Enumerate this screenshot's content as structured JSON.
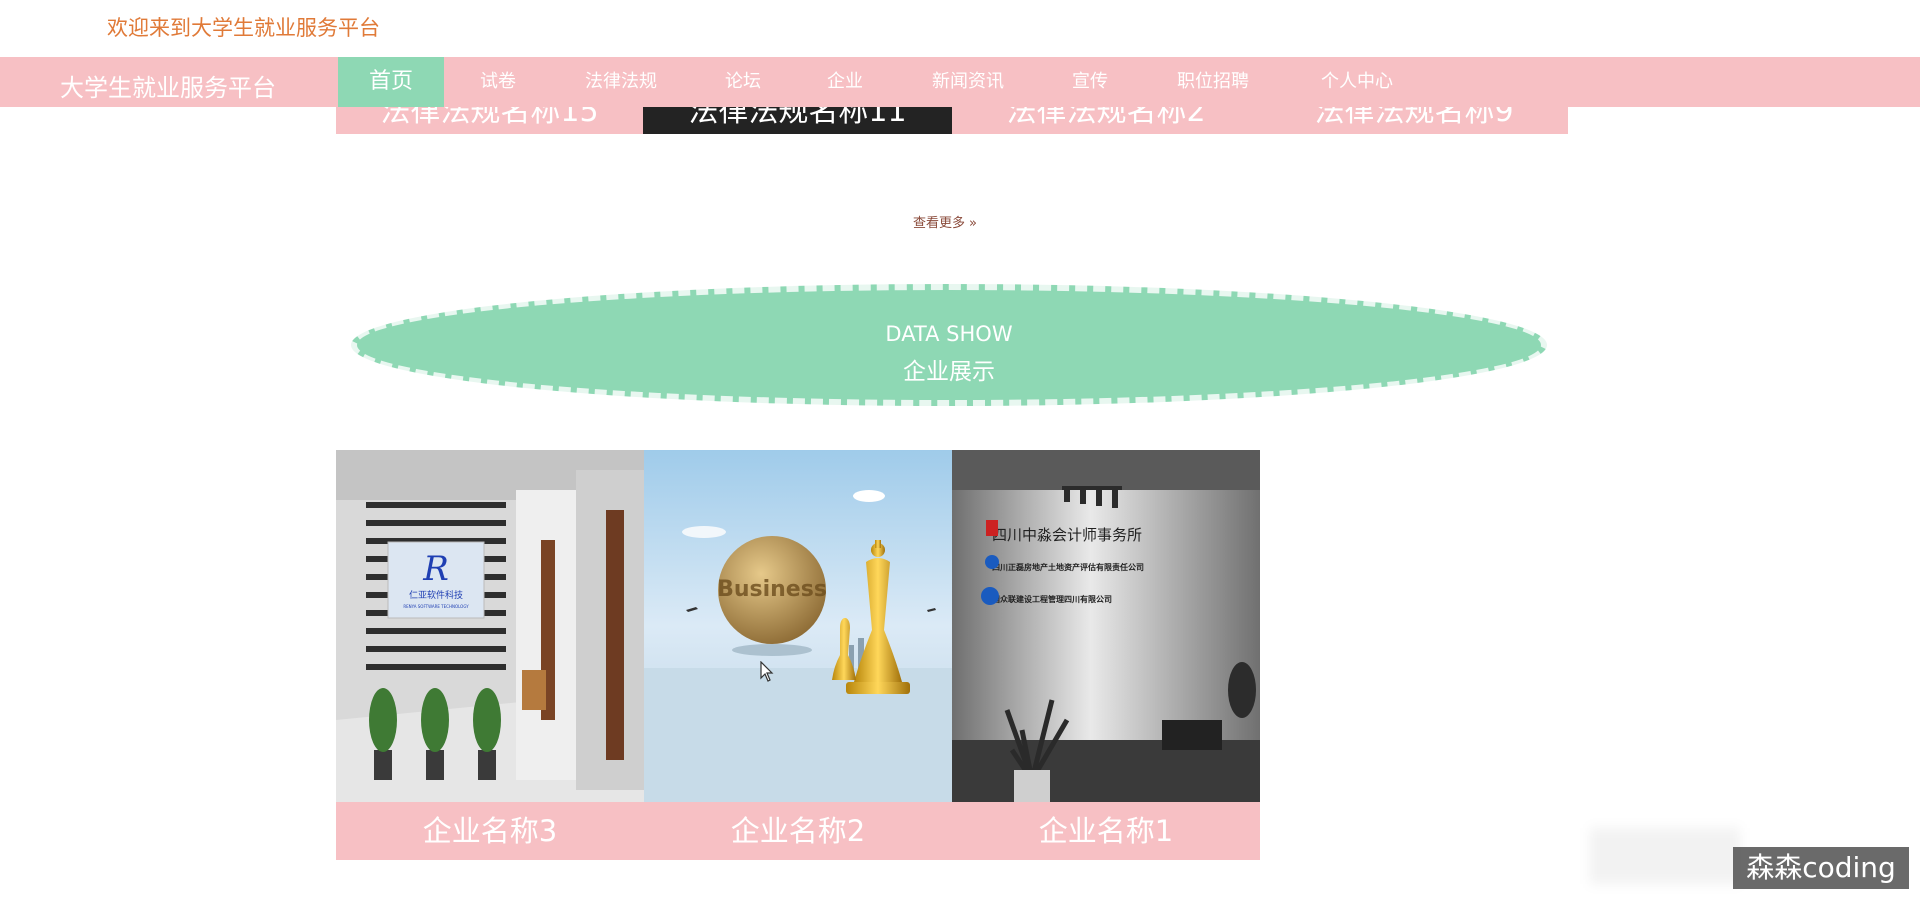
{
  "header": {
    "welcome": "欢迎来到大学生就业服务平台"
  },
  "nav": {
    "brand": "大学生就业服务平台",
    "items": [
      {
        "label": "首页",
        "active": true
      },
      {
        "label": "试卷"
      },
      {
        "label": "法律法规"
      },
      {
        "label": "论坛"
      },
      {
        "label": "企业"
      },
      {
        "label": "新闻资讯"
      },
      {
        "label": "宣传"
      },
      {
        "label": "职位招聘"
      },
      {
        "label": "个人中心"
      }
    ]
  },
  "carousel": {
    "items": [
      "法律法规名称15",
      "法律法规名称11",
      "法律法规名称2",
      "法律法规名称9"
    ]
  },
  "view_more": {
    "label": "查看更多",
    "icon": "double-chevron-right-icon"
  },
  "section": {
    "title_en": "DATA SHOW",
    "title_cn": "企业展示"
  },
  "companies": [
    {
      "name": "企业名称3",
      "sign_text": "仁亚软件科技",
      "sign_sub": "RENYA SOFTWARE TECHNOLOGY"
    },
    {
      "name": "企业名称2",
      "globe_word": "Business"
    },
    {
      "name": "企业名称1",
      "wall_lines": [
        "四川中淼会计师事务所",
        "四川正磊房地产土地资产评估有限责任公司",
        "国众联建设工程管理四川有限公司"
      ]
    }
  ],
  "watermark": {
    "text": "森森coding"
  },
  "colors": {
    "pink": "#f7c0c4",
    "green": "#8ed8b4",
    "orange": "#e07a38"
  }
}
